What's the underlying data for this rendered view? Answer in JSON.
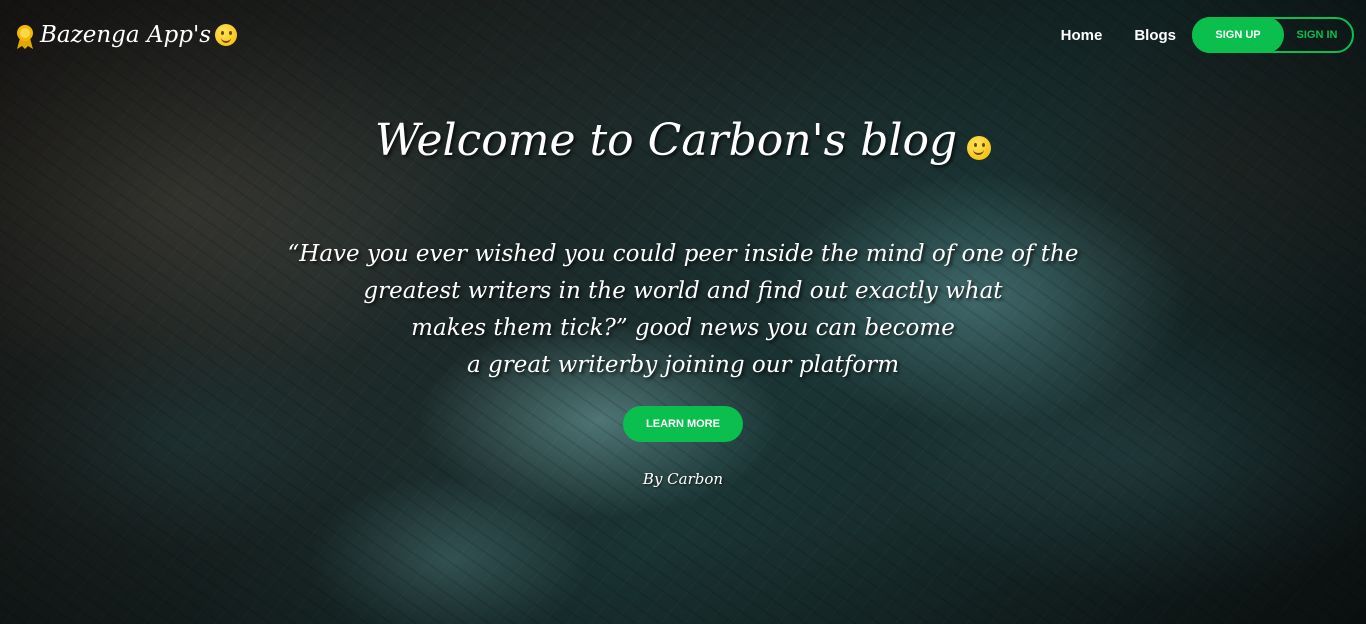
{
  "brand": {
    "name": "Bazenga App's",
    "badge_icon": "award-badge-icon",
    "emoji_icon": "smiley-face-icon"
  },
  "nav": {
    "links": [
      "Home",
      "Blogs"
    ],
    "signup_label": "SIGN UP",
    "signin_label": "SIGN IN"
  },
  "hero": {
    "title": "Welcome to Carbon's blog",
    "title_icon": "smiley-face-icon",
    "quote_lines": [
      "“Have you ever wished you could peer inside the mind of one of the",
      "greatest writers in the world and find out exactly what",
      "makes them tick?” good news you can become",
      "a great writerby joining our platform"
    ],
    "cta_label": "LEARN MORE",
    "byline": "By Carbon"
  },
  "colors": {
    "accent": "#0bbf4f",
    "emoji": "#f5b800"
  }
}
